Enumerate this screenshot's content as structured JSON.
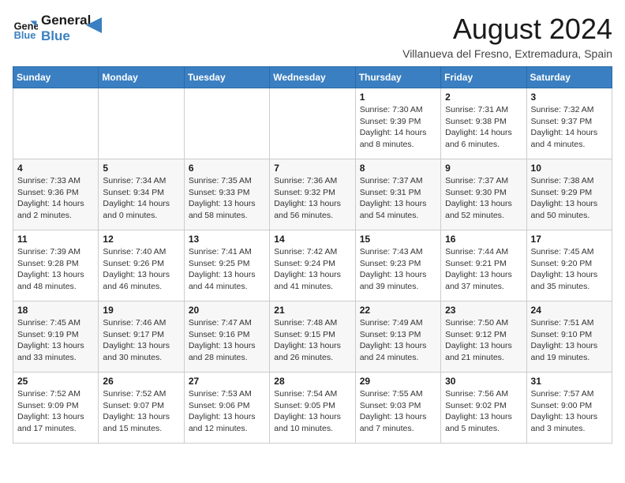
{
  "logo": {
    "line1": "General",
    "line2": "Blue"
  },
  "title": "August 2024",
  "subtitle": "Villanueva del Fresno, Extremadura, Spain",
  "weekdays": [
    "Sunday",
    "Monday",
    "Tuesday",
    "Wednesday",
    "Thursday",
    "Friday",
    "Saturday"
  ],
  "weeks": [
    [
      {
        "day": "",
        "info": ""
      },
      {
        "day": "",
        "info": ""
      },
      {
        "day": "",
        "info": ""
      },
      {
        "day": "",
        "info": ""
      },
      {
        "day": "1",
        "info": "Sunrise: 7:30 AM\nSunset: 9:39 PM\nDaylight: 14 hours and 8 minutes."
      },
      {
        "day": "2",
        "info": "Sunrise: 7:31 AM\nSunset: 9:38 PM\nDaylight: 14 hours and 6 minutes."
      },
      {
        "day": "3",
        "info": "Sunrise: 7:32 AM\nSunset: 9:37 PM\nDaylight: 14 hours and 4 minutes."
      }
    ],
    [
      {
        "day": "4",
        "info": "Sunrise: 7:33 AM\nSunset: 9:36 PM\nDaylight: 14 hours and 2 minutes."
      },
      {
        "day": "5",
        "info": "Sunrise: 7:34 AM\nSunset: 9:34 PM\nDaylight: 14 hours and 0 minutes."
      },
      {
        "day": "6",
        "info": "Sunrise: 7:35 AM\nSunset: 9:33 PM\nDaylight: 13 hours and 58 minutes."
      },
      {
        "day": "7",
        "info": "Sunrise: 7:36 AM\nSunset: 9:32 PM\nDaylight: 13 hours and 56 minutes."
      },
      {
        "day": "8",
        "info": "Sunrise: 7:37 AM\nSunset: 9:31 PM\nDaylight: 13 hours and 54 minutes."
      },
      {
        "day": "9",
        "info": "Sunrise: 7:37 AM\nSunset: 9:30 PM\nDaylight: 13 hours and 52 minutes."
      },
      {
        "day": "10",
        "info": "Sunrise: 7:38 AM\nSunset: 9:29 PM\nDaylight: 13 hours and 50 minutes."
      }
    ],
    [
      {
        "day": "11",
        "info": "Sunrise: 7:39 AM\nSunset: 9:28 PM\nDaylight: 13 hours and 48 minutes."
      },
      {
        "day": "12",
        "info": "Sunrise: 7:40 AM\nSunset: 9:26 PM\nDaylight: 13 hours and 46 minutes."
      },
      {
        "day": "13",
        "info": "Sunrise: 7:41 AM\nSunset: 9:25 PM\nDaylight: 13 hours and 44 minutes."
      },
      {
        "day": "14",
        "info": "Sunrise: 7:42 AM\nSunset: 9:24 PM\nDaylight: 13 hours and 41 minutes."
      },
      {
        "day": "15",
        "info": "Sunrise: 7:43 AM\nSunset: 9:23 PM\nDaylight: 13 hours and 39 minutes."
      },
      {
        "day": "16",
        "info": "Sunrise: 7:44 AM\nSunset: 9:21 PM\nDaylight: 13 hours and 37 minutes."
      },
      {
        "day": "17",
        "info": "Sunrise: 7:45 AM\nSunset: 9:20 PM\nDaylight: 13 hours and 35 minutes."
      }
    ],
    [
      {
        "day": "18",
        "info": "Sunrise: 7:45 AM\nSunset: 9:19 PM\nDaylight: 13 hours and 33 minutes."
      },
      {
        "day": "19",
        "info": "Sunrise: 7:46 AM\nSunset: 9:17 PM\nDaylight: 13 hours and 30 minutes."
      },
      {
        "day": "20",
        "info": "Sunrise: 7:47 AM\nSunset: 9:16 PM\nDaylight: 13 hours and 28 minutes."
      },
      {
        "day": "21",
        "info": "Sunrise: 7:48 AM\nSunset: 9:15 PM\nDaylight: 13 hours and 26 minutes."
      },
      {
        "day": "22",
        "info": "Sunrise: 7:49 AM\nSunset: 9:13 PM\nDaylight: 13 hours and 24 minutes."
      },
      {
        "day": "23",
        "info": "Sunrise: 7:50 AM\nSunset: 9:12 PM\nDaylight: 13 hours and 21 minutes."
      },
      {
        "day": "24",
        "info": "Sunrise: 7:51 AM\nSunset: 9:10 PM\nDaylight: 13 hours and 19 minutes."
      }
    ],
    [
      {
        "day": "25",
        "info": "Sunrise: 7:52 AM\nSunset: 9:09 PM\nDaylight: 13 hours and 17 minutes."
      },
      {
        "day": "26",
        "info": "Sunrise: 7:52 AM\nSunset: 9:07 PM\nDaylight: 13 hours and 15 minutes."
      },
      {
        "day": "27",
        "info": "Sunrise: 7:53 AM\nSunset: 9:06 PM\nDaylight: 13 hours and 12 minutes."
      },
      {
        "day": "28",
        "info": "Sunrise: 7:54 AM\nSunset: 9:05 PM\nDaylight: 13 hours and 10 minutes."
      },
      {
        "day": "29",
        "info": "Sunrise: 7:55 AM\nSunset: 9:03 PM\nDaylight: 13 hours and 7 minutes."
      },
      {
        "day": "30",
        "info": "Sunrise: 7:56 AM\nSunset: 9:02 PM\nDaylight: 13 hours and 5 minutes."
      },
      {
        "day": "31",
        "info": "Sunrise: 7:57 AM\nSunset: 9:00 PM\nDaylight: 13 hours and 3 minutes."
      }
    ]
  ]
}
